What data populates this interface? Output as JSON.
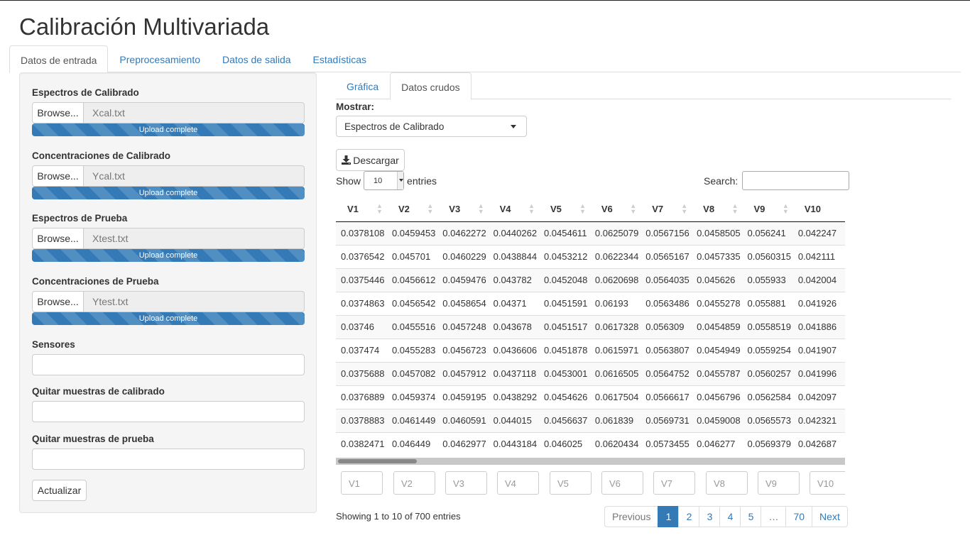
{
  "app": {
    "title": "Calibración Multivariada"
  },
  "main_tabs": [
    {
      "label": "Datos de entrada",
      "active": true
    },
    {
      "label": "Preprocesamiento",
      "active": false
    },
    {
      "label": "Datos de salida",
      "active": false
    },
    {
      "label": "Estadísticas",
      "active": false
    }
  ],
  "sidebar": {
    "file_inputs": [
      {
        "label": "Espectros de Calibrado",
        "button": "Browse...",
        "filename": "Xcal.txt",
        "status": "Upload complete",
        "progress": 1.0
      },
      {
        "label": "Concentraciones de Calibrado",
        "button": "Browse...",
        "filename": "Ycal.txt",
        "status": "Upload complete",
        "progress": 1.0
      },
      {
        "label": "Espectros de Prueba",
        "button": "Browse...",
        "filename": "Xtest.txt",
        "status": "Upload complete",
        "progress": 1.0
      },
      {
        "label": "Concentraciones de Prueba",
        "button": "Browse...",
        "filename": "Ytest.txt",
        "status": "Upload complete",
        "progress": 1.0
      }
    ],
    "text_inputs": [
      {
        "label": "Sensores",
        "value": ""
      },
      {
        "label": "Quitar muestras de calibrado",
        "value": ""
      },
      {
        "label": "Quitar muestras de prueba",
        "value": ""
      }
    ],
    "update_button": "Actualizar"
  },
  "sub_tabs": [
    {
      "label": "Gráfica",
      "active": false
    },
    {
      "label": "Datos crudos",
      "active": true
    }
  ],
  "dataset_select": {
    "label": "Mostrar:",
    "value": "Espectros de Calibrado"
  },
  "download_button": "Descargar",
  "table_controls": {
    "show_label": "Show",
    "length_value": "10",
    "entries_label": "entries",
    "search_label": "Search:",
    "search_value": ""
  },
  "table": {
    "columns": [
      "V1",
      "V2",
      "V3",
      "V4",
      "V5",
      "V6",
      "V7",
      "V8",
      "V9",
      "V10"
    ],
    "rows": [
      [
        "0.0378108",
        "0.0459453",
        "0.0462272",
        "0.0440262",
        "0.0454611",
        "0.0625079",
        "0.0567156",
        "0.0458505",
        "0.056241",
        "0.042247"
      ],
      [
        "0.0376542",
        "0.045701",
        "0.0460229",
        "0.0438844",
        "0.0453212",
        "0.0622344",
        "0.0565167",
        "0.0457335",
        "0.0560315",
        "0.042111"
      ],
      [
        "0.0375446",
        "0.0456612",
        "0.0459476",
        "0.043782",
        "0.0452048",
        "0.0620698",
        "0.0564035",
        "0.045626",
        "0.055933",
        "0.042004"
      ],
      [
        "0.0374863",
        "0.0456542",
        "0.0458654",
        "0.04371",
        "0.0451591",
        "0.06193",
        "0.0563486",
        "0.0455278",
        "0.055881",
        "0.041926"
      ],
      [
        "0.03746",
        "0.0455516",
        "0.0457248",
        "0.043678",
        "0.0451517",
        "0.0617328",
        "0.056309",
        "0.0454859",
        "0.0558519",
        "0.041886"
      ],
      [
        "0.037474",
        "0.0455283",
        "0.0456723",
        "0.0436606",
        "0.0451878",
        "0.0615971",
        "0.0563807",
        "0.0454949",
        "0.0559254",
        "0.041907"
      ],
      [
        "0.0375688",
        "0.0457082",
        "0.0457912",
        "0.0437118",
        "0.0453001",
        "0.0616505",
        "0.0564752",
        "0.0455787",
        "0.0560257",
        "0.041996"
      ],
      [
        "0.0376889",
        "0.0459374",
        "0.0459195",
        "0.0438292",
        "0.0454626",
        "0.0617504",
        "0.0566617",
        "0.0456796",
        "0.0562584",
        "0.042097"
      ],
      [
        "0.0378883",
        "0.0461449",
        "0.0460591",
        "0.044015",
        "0.0456637",
        "0.061839",
        "0.0569731",
        "0.0459008",
        "0.0565573",
        "0.042321"
      ],
      [
        "0.0382471",
        "0.046449",
        "0.0462977",
        "0.0443184",
        "0.046025",
        "0.0620434",
        "0.0573455",
        "0.046277",
        "0.0569379",
        "0.042687"
      ]
    ],
    "filter_placeholders": [
      "V1",
      "V2",
      "V3",
      "V4",
      "V5",
      "V6",
      "V7",
      "V8",
      "V9",
      "V10"
    ]
  },
  "table_info": "Showing 1 to 10 of 700 entries",
  "pagination": {
    "previous": "Previous",
    "pages": [
      "1",
      "2",
      "3",
      "4",
      "5",
      "…",
      "70"
    ],
    "current": "1",
    "next": "Next"
  },
  "icons": {
    "download": "download-icon",
    "sort": "sort-both-icon",
    "dropdown": "caret-down-icon"
  },
  "colors": {
    "primary": "#337ab7",
    "sidebar_bg": "#f5f5f5",
    "progress": "#337ab7"
  }
}
